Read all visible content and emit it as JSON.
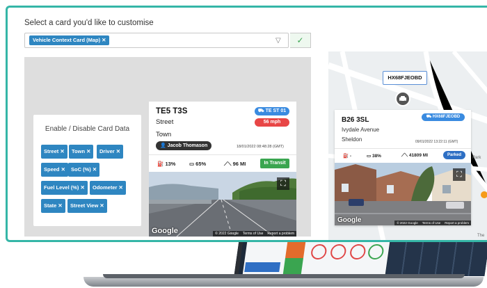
{
  "select": {
    "title": "Select a card you'd like to customise",
    "chip": "Vehicle Context Card (Map) ✕",
    "arrow": "▽",
    "confirm": "✓"
  },
  "toggles": {
    "title": "Enable / Disable Card Data",
    "items": [
      "Street ✕",
      "Town ✕",
      "Driver ✕",
      "Speed ✕",
      "SoC (%) ✕",
      "Fuel Level (%) ✕",
      "Odometer ✕",
      "State ✕",
      "Street View ✕"
    ]
  },
  "vehicle_card": {
    "reg": "TE5 T3S",
    "group": "TE ST 01",
    "speed": "56 mph",
    "street": "Street",
    "town": "Town",
    "driver": "Jacob Thomason",
    "timestamp": "18/01/2022 08:48:28 (GMT)",
    "fuel": "13%",
    "soc": "65%",
    "odometer": "96 MI",
    "status": "In Transit",
    "google": "Google",
    "footer": [
      "© 2022 Google",
      "Terms of Use",
      "Report a problem"
    ]
  },
  "map_card": {
    "reg_pill": "HX68FJEOBD",
    "reg": "B26 3SL",
    "group": "HX68FJEOBD",
    "street": "Ivydale Avenue",
    "town": "Sheldon",
    "timestamp": "09/01/2022 13:22:11 (GMT)",
    "fuel": "-",
    "soc": "38%",
    "odometer": "41809 MI",
    "status": "Parked",
    "google": "Google",
    "footer": [
      "© 2022 Google",
      "Terms of Use",
      "Report a problem"
    ],
    "labels": [
      "Park",
      "The"
    ]
  },
  "colors": {
    "frame": "#35b6a7",
    "chip": "#2e86c1",
    "in_transit": "#3aa550",
    "speed": "#e84646",
    "parked": "#2e6fc4"
  }
}
